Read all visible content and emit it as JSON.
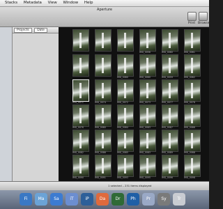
{
  "menubar": {
    "items": [
      "Stacks",
      "Metadata",
      "View",
      "Window",
      "Help"
    ]
  },
  "window": {
    "title": "Aperture"
  },
  "toolbar": {
    "print": "Print",
    "browser": "Browser"
  },
  "panel": {
    "dropdown1": "Projects",
    "dropdown2": "Date"
  },
  "grid": {
    "captions": [
      "",
      "",
      "",
      "IMG_0056",
      "IMG_0060",
      "IMG_0061",
      "",
      "",
      "IMG_0060",
      "IMG_0060",
      "IMG_0059",
      "IMG_0062",
      "IMG_0071",
      "IMG_0074",
      "IMG_0072",
      "IMG_0073",
      "IMG_0077",
      "IMG_0078",
      "IMG_0076",
      "IMG_0080",
      "IMG_0084",
      "IMG_0083",
      "IMG_0087",
      "IMG_0086",
      "IMG_0082",
      "IMG_0086",
      "IMG_0085",
      "IMG_0083",
      "IMG_0089",
      "IMG_0088",
      "IMG_0090",
      "IMG_0091",
      "IMG_0093",
      "IMG_0095",
      "IMG_0096",
      "IMG_0098"
    ]
  },
  "status": {
    "text": "1 selected – 231 items displayed"
  },
  "dock": {
    "items": [
      "Finder",
      "Mail",
      "Safari",
      "iTunes",
      "iPhoto",
      "Dashboard",
      "Dreamweaver",
      "Photoshop",
      "Preview",
      "System Preferences",
      "Trash"
    ]
  }
}
